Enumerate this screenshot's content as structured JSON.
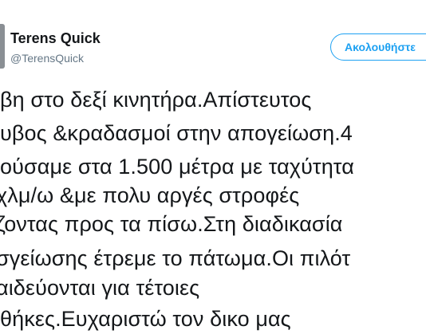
{
  "user": {
    "display_name": "Terens Quick",
    "handle": "@TerensQuick"
  },
  "actions": {
    "follow_label": "Ακολουθήστε"
  },
  "tweet": {
    "lines": [
      "βη στο δεξί κινητήρα.Απίστευτος",
      "υβος &κραδασμοί στην απογείωση.4",
      "ούσαμε στα 1.500 μέτρα με ταχύτητα",
      "χλμ/ω &με πολυ αργές στροφές",
      "ζοντας προς τα πίσω.Στη διαδικασία",
      "σγείωσης έτρεμε το πάτωμα.Οι πιλότ",
      "αιδεύονται για τέτοιες",
      "θήκες.Ευχαριστώ τον δικο μας"
    ]
  },
  "colors": {
    "text": "#14171a",
    "secondary_text": "#657786",
    "accent": "#1da1f2",
    "background": "#ffffff"
  }
}
